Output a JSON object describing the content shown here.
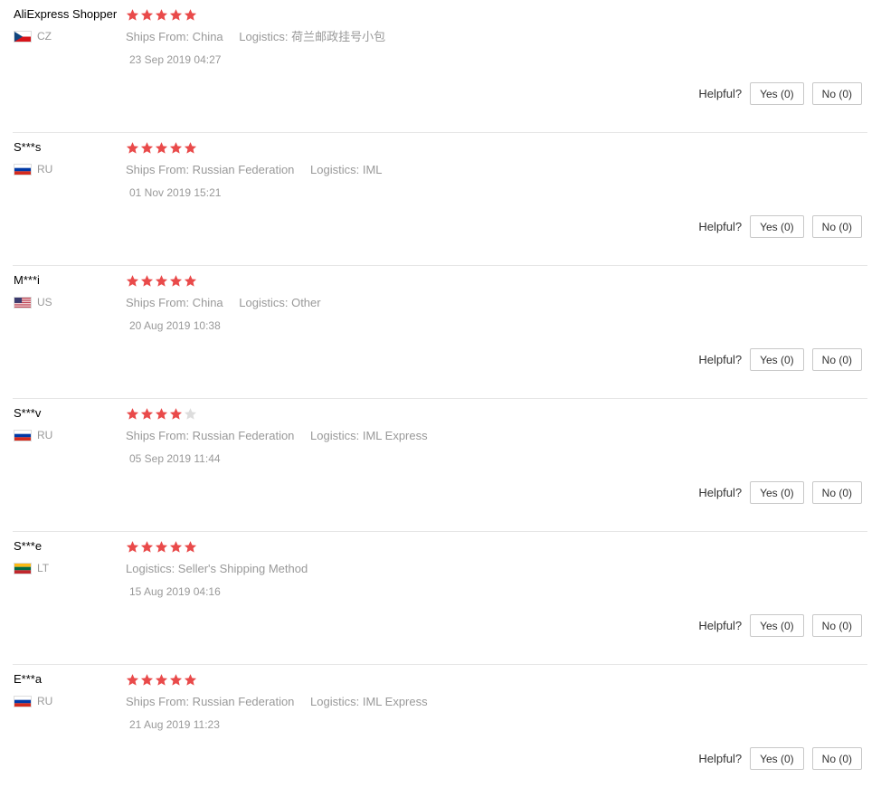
{
  "colors": {
    "star_on": "#e94a4a",
    "star_off": "#dddddd",
    "divider": "#e6e6e6",
    "muted_text": "#999999"
  },
  "helpful_label": "Helpful?",
  "reviews": [
    {
      "user": "AliExpress Shopper",
      "country": "CZ",
      "flag": "cz",
      "rating": 5,
      "ships_from": "Ships From: China",
      "logistics": "Logistics: 荷兰邮政挂号小包",
      "date": "23 Sep 2019 04:27",
      "yes": "Yes (0)",
      "no": "No (0)"
    },
    {
      "user": "S***s",
      "country": "RU",
      "flag": "ru",
      "rating": 5,
      "ships_from": "Ships From: Russian Federation",
      "logistics": "Logistics: IML",
      "date": "01 Nov 2019 15:21",
      "yes": "Yes (0)",
      "no": "No (0)"
    },
    {
      "user": "M***i",
      "country": "US",
      "flag": "us",
      "rating": 5,
      "ships_from": "Ships From: China",
      "logistics": "Logistics: Other",
      "date": "20 Aug 2019 10:38",
      "yes": "Yes (0)",
      "no": "No (0)"
    },
    {
      "user": "S***v",
      "country": "RU",
      "flag": "ru",
      "rating": 4,
      "ships_from": "Ships From: Russian Federation",
      "logistics": "Logistics: IML Express",
      "date": "05 Sep 2019 11:44",
      "yes": "Yes (0)",
      "no": "No (0)"
    },
    {
      "user": "S***e",
      "country": "LT",
      "flag": "lt",
      "rating": 5,
      "ships_from": "",
      "logistics": "Logistics: Seller's Shipping Method",
      "date": "15 Aug 2019 04:16",
      "yes": "Yes (0)",
      "no": "No (0)"
    },
    {
      "user": "E***a",
      "country": "RU",
      "flag": "ru",
      "rating": 5,
      "ships_from": "Ships From: Russian Federation",
      "logistics": "Logistics: IML Express",
      "date": "21 Aug 2019 11:23",
      "yes": "Yes (0)",
      "no": "No (0)"
    }
  ]
}
